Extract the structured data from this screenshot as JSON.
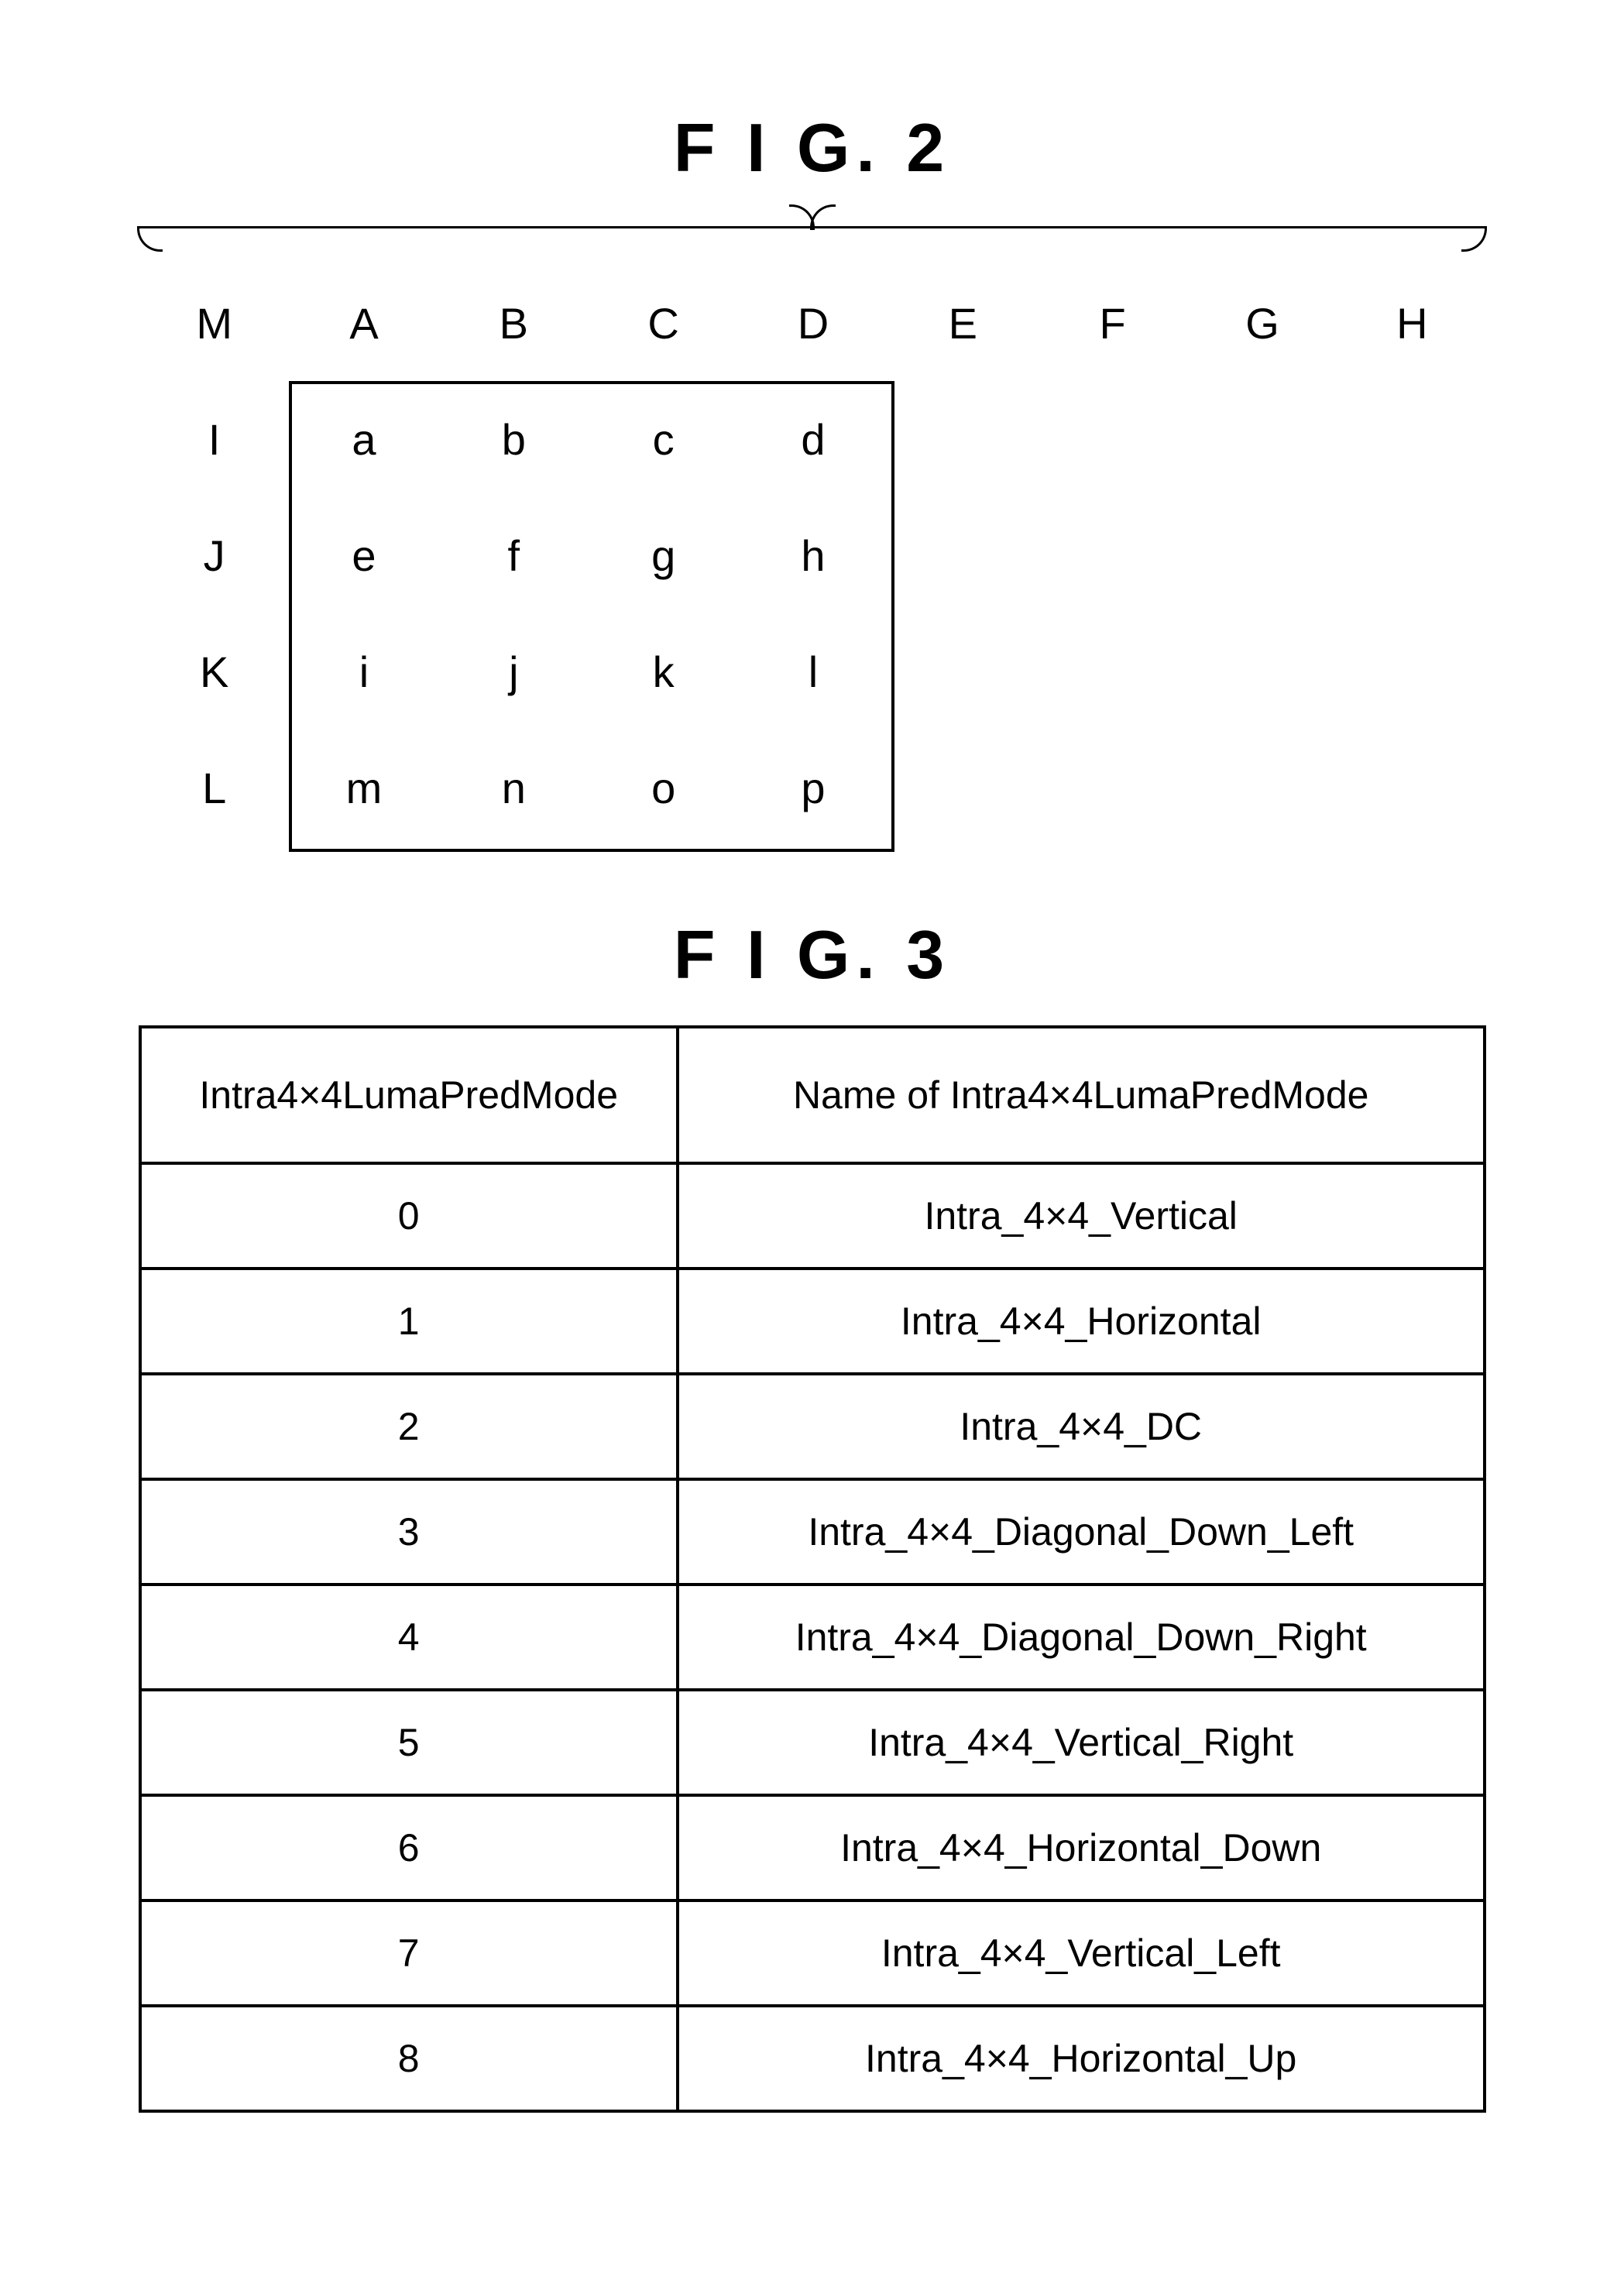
{
  "fig2": {
    "title": "F I G.   2",
    "top_row": [
      "M",
      "A",
      "B",
      "C",
      "D",
      "E",
      "F",
      "G",
      "H"
    ],
    "left_col": [
      "I",
      "J",
      "K",
      "L"
    ],
    "inner": [
      [
        "a",
        "b",
        "c",
        "d"
      ],
      [
        "e",
        "f",
        "g",
        "h"
      ],
      [
        "i",
        "j",
        "k",
        "l"
      ],
      [
        "m",
        "n",
        "o",
        "p"
      ]
    ]
  },
  "fig3": {
    "title": "F I G.   3",
    "headers": {
      "mode": "Intra4×4LumaPredMode",
      "name": "Name  of  Intra4×4LumaPredMode"
    },
    "rows": [
      {
        "mode": "0",
        "name": "Intra_4×4_Vertical"
      },
      {
        "mode": "1",
        "name": "Intra_4×4_Horizontal"
      },
      {
        "mode": "2",
        "name": "Intra_4×4_DC"
      },
      {
        "mode": "3",
        "name": "Intra_4×4_Diagonal_Down_Left"
      },
      {
        "mode": "4",
        "name": "Intra_4×4_Diagonal_Down_Right"
      },
      {
        "mode": "5",
        "name": "Intra_4×4_Vertical_Right"
      },
      {
        "mode": "6",
        "name": "Intra_4×4_Horizontal_Down"
      },
      {
        "mode": "7",
        "name": "Intra_4×4_Vertical_Left"
      },
      {
        "mode": "8",
        "name": "Intra_4×4_Horizontal_Up"
      }
    ]
  }
}
